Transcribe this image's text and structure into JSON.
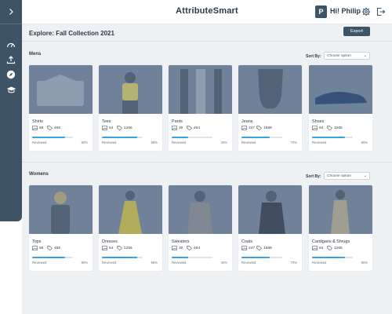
{
  "app": {
    "title": "AttributeSmart"
  },
  "user": {
    "avatar_initial": "P",
    "greeting": "Hi! Philip"
  },
  "header": {
    "settings_icon": "gear-icon",
    "logout_icon": "logout-icon"
  },
  "sidebar": {
    "toggle_icon": "chevron-right-icon",
    "items": [
      {
        "icon": "dashboard-gauge-icon"
      },
      {
        "icon": "upload-icon"
      },
      {
        "icon": "compass-icon",
        "active": true
      },
      {
        "icon": "graduation-cap-icon"
      }
    ]
  },
  "page": {
    "title": "Explore: Fall Collection 2021",
    "export_label": "Export"
  },
  "labels": {
    "reviewed": "Reviewed"
  },
  "sections": [
    {
      "title": "Mens",
      "sort_label": "Sort By:",
      "sort_value": "Choose option",
      "cards": [
        {
          "name": "Shirts",
          "images": "56",
          "tags": "456",
          "progress_pct": 80,
          "pct_label": "80%"
        },
        {
          "name": "Tees",
          "images": "54",
          "tags": "1266",
          "progress_pct": 86,
          "pct_label": "86%"
        },
        {
          "name": "Pants",
          "images": "30",
          "tags": "464",
          "progress_pct": 40,
          "pct_label": "40%"
        },
        {
          "name": "Jeans",
          "images": "247",
          "tags": "1589",
          "progress_pct": 70,
          "pct_label": "70%"
        },
        {
          "name": "Shoes",
          "images": "84",
          "tags": "1265",
          "progress_pct": 80,
          "pct_label": "80%"
        }
      ]
    },
    {
      "title": "Womens",
      "sort_label": "Sort By:",
      "sort_value": "Choose option",
      "cards": [
        {
          "name": "Tops",
          "images": "56",
          "tags": "456",
          "progress_pct": 80,
          "pct_label": "80%"
        },
        {
          "name": "Dresses",
          "images": "54",
          "tags": "1266",
          "progress_pct": 86,
          "pct_label": "86%"
        },
        {
          "name": "Sweaters",
          "images": "30",
          "tags": "464",
          "progress_pct": 40,
          "pct_label": "40%"
        },
        {
          "name": "Coats",
          "images": "247",
          "tags": "1589",
          "progress_pct": 70,
          "pct_label": "70%"
        },
        {
          "name": "Cardigans & Shrugs",
          "images": "84",
          "tags": "1265",
          "progress_pct": 80,
          "pct_label": "80%"
        }
      ]
    }
  ],
  "colors": {
    "primary": "#3d5466",
    "progress": "#3aa0e8",
    "image_tint": "#6f8299"
  }
}
